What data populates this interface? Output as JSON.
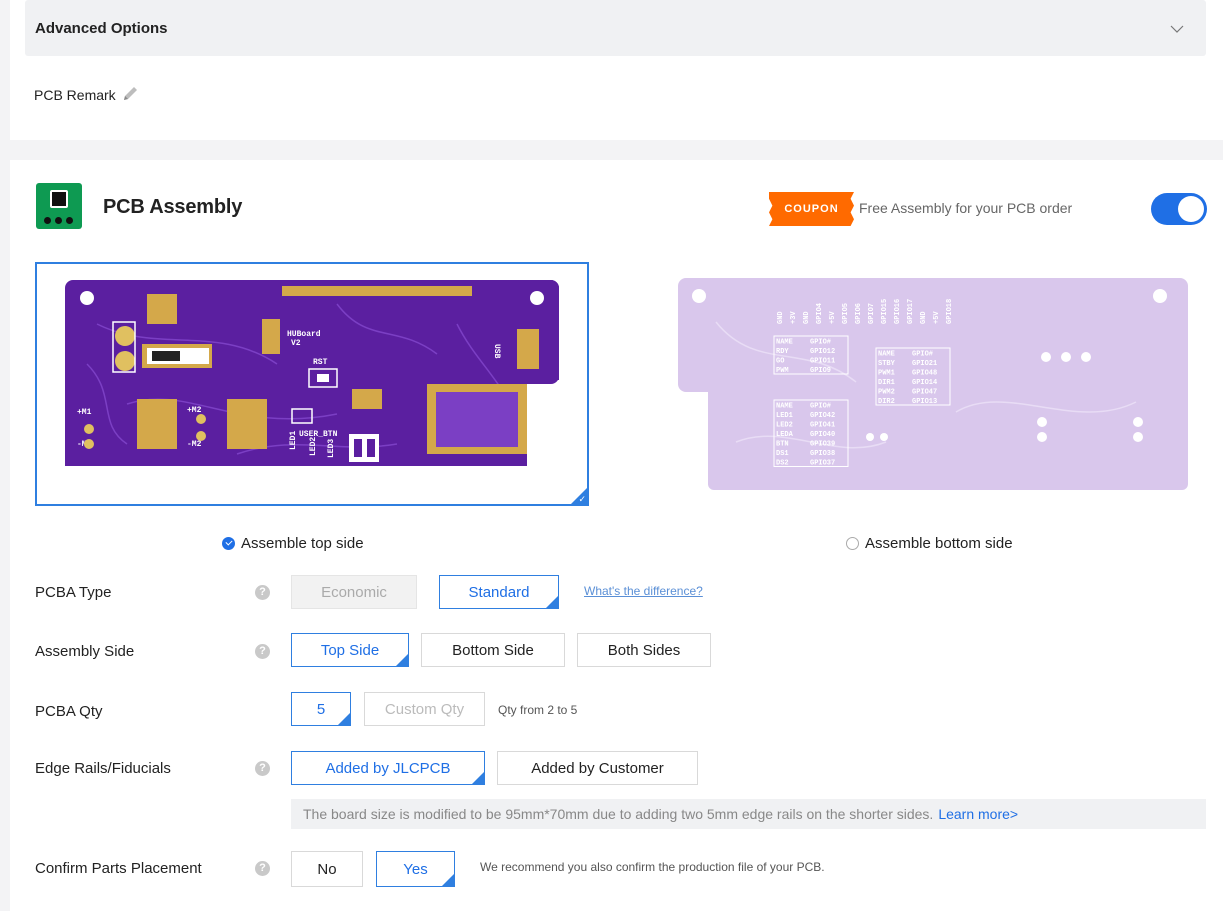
{
  "advanced": {
    "title": "Advanced Options",
    "remark_label": "PCB Remark"
  },
  "assembly": {
    "title": "PCB Assembly",
    "coupon_badge": "COUPON",
    "coupon_text": "Free Assembly for your PCB order",
    "enabled": true
  },
  "board_top": {
    "labels": {
      "hub": "HUBoard",
      "ver": "V2",
      "rst": "RST",
      "usr": "USER_BTN",
      "usb": "USB",
      "m1p": "+M1",
      "m1n": "-M1",
      "m2p": "+M2",
      "m2n": "-M2",
      "led1": "LED1",
      "led2": "LED2",
      "led3": "LED3"
    }
  },
  "board_bottom": {
    "table1": {
      "header": [
        "NAME",
        "GPIO#"
      ],
      "rows": [
        [
          "RDY",
          "GPIO12"
        ],
        [
          "GO",
          "GPIO11"
        ],
        [
          "PWM",
          "GPIO9"
        ]
      ]
    },
    "table2": {
      "header": [
        "NAME",
        "GPIO#"
      ],
      "rows": [
        [
          "LED1",
          "GPIO42"
        ],
        [
          "LED2",
          "GPIO41"
        ],
        [
          "LEDA",
          "GPIO40"
        ],
        [
          "BTN",
          "GPIO39"
        ],
        [
          "DS1",
          "GPIO38"
        ],
        [
          "DS2",
          "GPIO37"
        ]
      ]
    },
    "table3": {
      "header": [
        "NAME",
        "GPIO#"
      ],
      "rows": [
        [
          "STBY",
          "GPIO21"
        ],
        [
          "PWM1",
          "GPIO48"
        ],
        [
          "DIR1",
          "GPIO14"
        ],
        [
          "PWM2",
          "GPIO47"
        ],
        [
          "DIR2",
          "GPIO13"
        ]
      ]
    },
    "header_pins": [
      "GND",
      "+3V",
      "GND",
      "GPIO4",
      "+5V",
      "GPIO5",
      "GPIO6",
      "GPIO7",
      "GPIO15",
      "GPIO16",
      "GPIO17",
      "GND",
      "+5V",
      "GPIO18"
    ]
  },
  "sides": {
    "top_label": "Assemble top side",
    "bottom_label": "Assemble bottom side",
    "selected": "top"
  },
  "pcba_type": {
    "label": "PCBA Type",
    "economic": "Economic",
    "standard": "Standard",
    "diff_link": "What's the difference?"
  },
  "assembly_side": {
    "label": "Assembly Side",
    "top": "Top Side",
    "bottom": "Bottom Side",
    "both": "Both Sides"
  },
  "qty": {
    "label": "PCBA Qty",
    "value": "5",
    "custom": "Custom Qty",
    "hint": "Qty from 2 to 5"
  },
  "edge": {
    "label": "Edge Rails/Fiducials",
    "jlc": "Added by JLCPCB",
    "customer": "Added by Customer",
    "info": "The board size is modified to be 95mm*70mm due to adding two 5mm edge rails on the shorter sides.",
    "learn_more": "Learn more>"
  },
  "confirm": {
    "label": "Confirm Parts Placement",
    "no": "No",
    "yes": "Yes",
    "hint": "We recommend you also confirm the production file of your PCB."
  },
  "colors": {
    "accent": "#1f6fe5",
    "board_top": "#5b1fa0",
    "board_bottom": "#d9c7ec",
    "coupon": "#ff6a00",
    "icon_bg": "#0e9a52"
  }
}
